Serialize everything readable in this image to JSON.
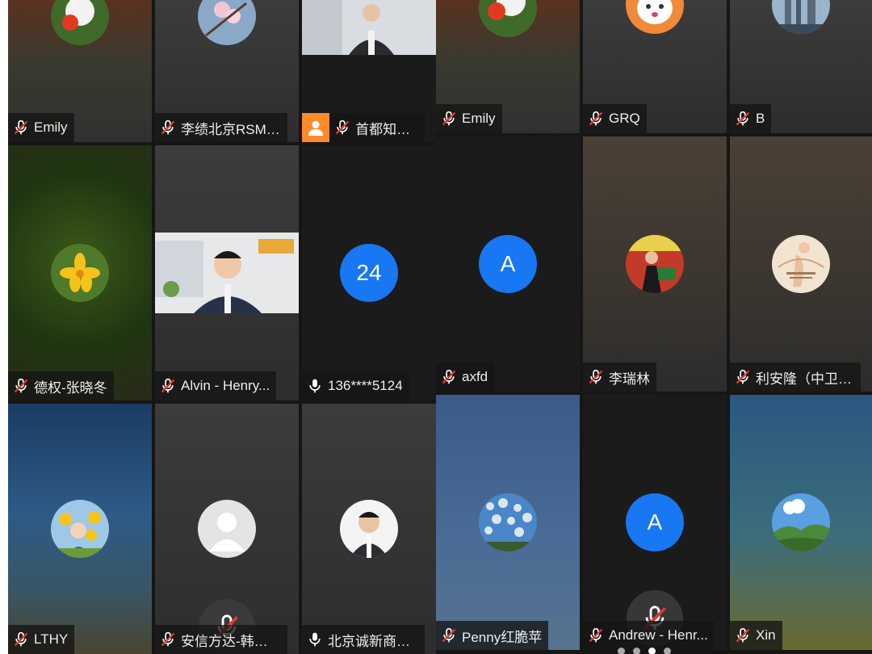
{
  "left_grid": [
    {
      "name": "Emily",
      "mic": "muted"
    },
    {
      "name": "李绩北京RSMK...",
      "mic": "muted"
    },
    {
      "name": "首都知识...",
      "mic": "muted"
    },
    {
      "name": "德权-张晓冬",
      "mic": "muted"
    },
    {
      "name": "Alvin - Henry...",
      "mic": "muted"
    },
    {
      "name": "136****5124",
      "mic": "on",
      "avatar_text": "24"
    },
    {
      "name": "LTHY",
      "mic": "muted"
    },
    {
      "name": "安信方达-韩倩倩",
      "mic": "muted"
    },
    {
      "name": "北京诚新商标版...",
      "mic": "on"
    }
  ],
  "right_grid": [
    {
      "name": "Emily",
      "mic": "muted"
    },
    {
      "name": "GRQ",
      "mic": "muted"
    },
    {
      "name": "B",
      "mic": "muted"
    },
    {
      "name": "axfd",
      "mic": "muted",
      "avatar_text": "A"
    },
    {
      "name": "李瑞林",
      "mic": "muted"
    },
    {
      "name": "利安隆（中卫）...",
      "mic": "muted"
    },
    {
      "name": "Penny红脆苹",
      "mic": "muted"
    },
    {
      "name": "Andrew - Henr...",
      "mic": "muted",
      "avatar_text": "A"
    },
    {
      "name": "Xin",
      "mic": "muted"
    }
  ],
  "pager": {
    "total": 4,
    "active": 3
  },
  "colors": {
    "accent_blue": "#1877f2",
    "badge_orange": "#ff8a2a",
    "muted_red": "#e53935"
  }
}
